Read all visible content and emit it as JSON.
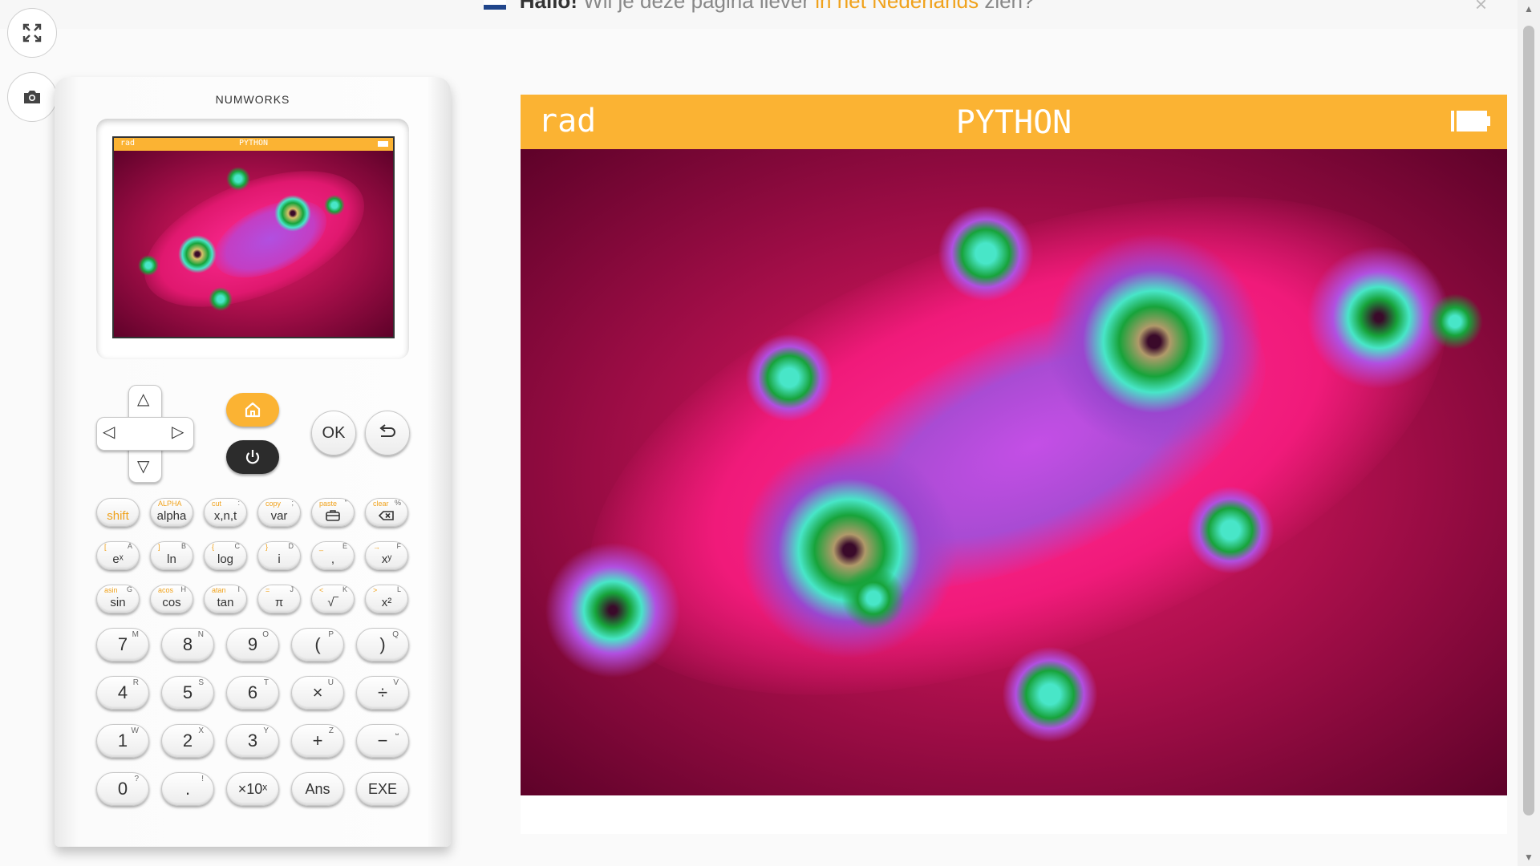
{
  "banner": {
    "greeting": "Hallo!",
    "question": "Wil je deze pagina liever",
    "link": "in het Nederlands",
    "suffix": "zien?",
    "close": "×"
  },
  "side_buttons": [
    {
      "icon": "fullscreen-icon"
    },
    {
      "icon": "camera-icon"
    }
  ],
  "calculator": {
    "brand": "NUMWORKS",
    "screen": {
      "angle_mode": "rad",
      "app_title": "PYTHON"
    },
    "function_keys": [
      {
        "secondary": "",
        "alpha": "",
        "label": "shift",
        "style": "orange"
      },
      {
        "secondary": "ALPHA",
        "alpha": "",
        "label": "alpha"
      },
      {
        "secondary": "cut",
        "alpha": ":",
        "label": "x,n,t"
      },
      {
        "secondary": "copy",
        "alpha": ";",
        "label": "var"
      },
      {
        "secondary": "paste",
        "alpha": "\"",
        "label": "toolbox-icon"
      },
      {
        "secondary": "clear",
        "alpha": "%",
        "label": "backspace-icon"
      },
      {
        "secondary": "[",
        "alpha": "A",
        "label": "eˣ"
      },
      {
        "secondary": "]",
        "alpha": "B",
        "label": "ln"
      },
      {
        "secondary": "{",
        "alpha": "C",
        "label": "log"
      },
      {
        "secondary": "}",
        "alpha": "D",
        "label": "i"
      },
      {
        "secondary": "_",
        "alpha": "E",
        "label": ","
      },
      {
        "secondary": "→",
        "alpha": "F",
        "label": "xʸ"
      },
      {
        "secondary": "asin",
        "alpha": "G",
        "label": "sin"
      },
      {
        "secondary": "acos",
        "alpha": "H",
        "label": "cos"
      },
      {
        "secondary": "atan",
        "alpha": "I",
        "label": "tan"
      },
      {
        "secondary": "=",
        "alpha": "J",
        "label": "π"
      },
      {
        "secondary": "<",
        "alpha": "K",
        "label": "√‾"
      },
      {
        "secondary": ">",
        "alpha": "L",
        "label": "x²"
      }
    ],
    "number_keys": [
      {
        "label": "7",
        "alpha": "M"
      },
      {
        "label": "8",
        "alpha": "N"
      },
      {
        "label": "9",
        "alpha": "O"
      },
      {
        "label": "(",
        "alpha": "P"
      },
      {
        "label": ")",
        "alpha": "Q"
      },
      {
        "label": "4",
        "alpha": "R"
      },
      {
        "label": "5",
        "alpha": "S"
      },
      {
        "label": "6",
        "alpha": "T"
      },
      {
        "label": "×",
        "alpha": "U"
      },
      {
        "label": "÷",
        "alpha": "V"
      },
      {
        "label": "1",
        "alpha": "W"
      },
      {
        "label": "2",
        "alpha": "X"
      },
      {
        "label": "3",
        "alpha": "Y"
      },
      {
        "label": "+",
        "alpha": "Z"
      },
      {
        "label": "−",
        "alpha": "⎵"
      },
      {
        "label": "0",
        "alpha": "?"
      },
      {
        "label": ".",
        "alpha": "!"
      },
      {
        "label": "×10ˣ",
        "alpha": ""
      },
      {
        "label": "Ans",
        "alpha": ""
      },
      {
        "label": "EXE",
        "alpha": ""
      }
    ],
    "ok_label": "OK",
    "dpad": {
      "up": "△",
      "down": "▽",
      "left": "◁",
      "right": "▷"
    }
  },
  "main_screen": {
    "angle_mode": "rad",
    "app_title": "PYTHON"
  },
  "colors": {
    "accent": "#fbb333",
    "fractal_bg": "#b0104e",
    "fractal_pink": "#ff1a8c",
    "fractal_purple": "#b14fe0",
    "fractal_green": "#17a33a",
    "fractal_cyan": "#48e6c8"
  }
}
